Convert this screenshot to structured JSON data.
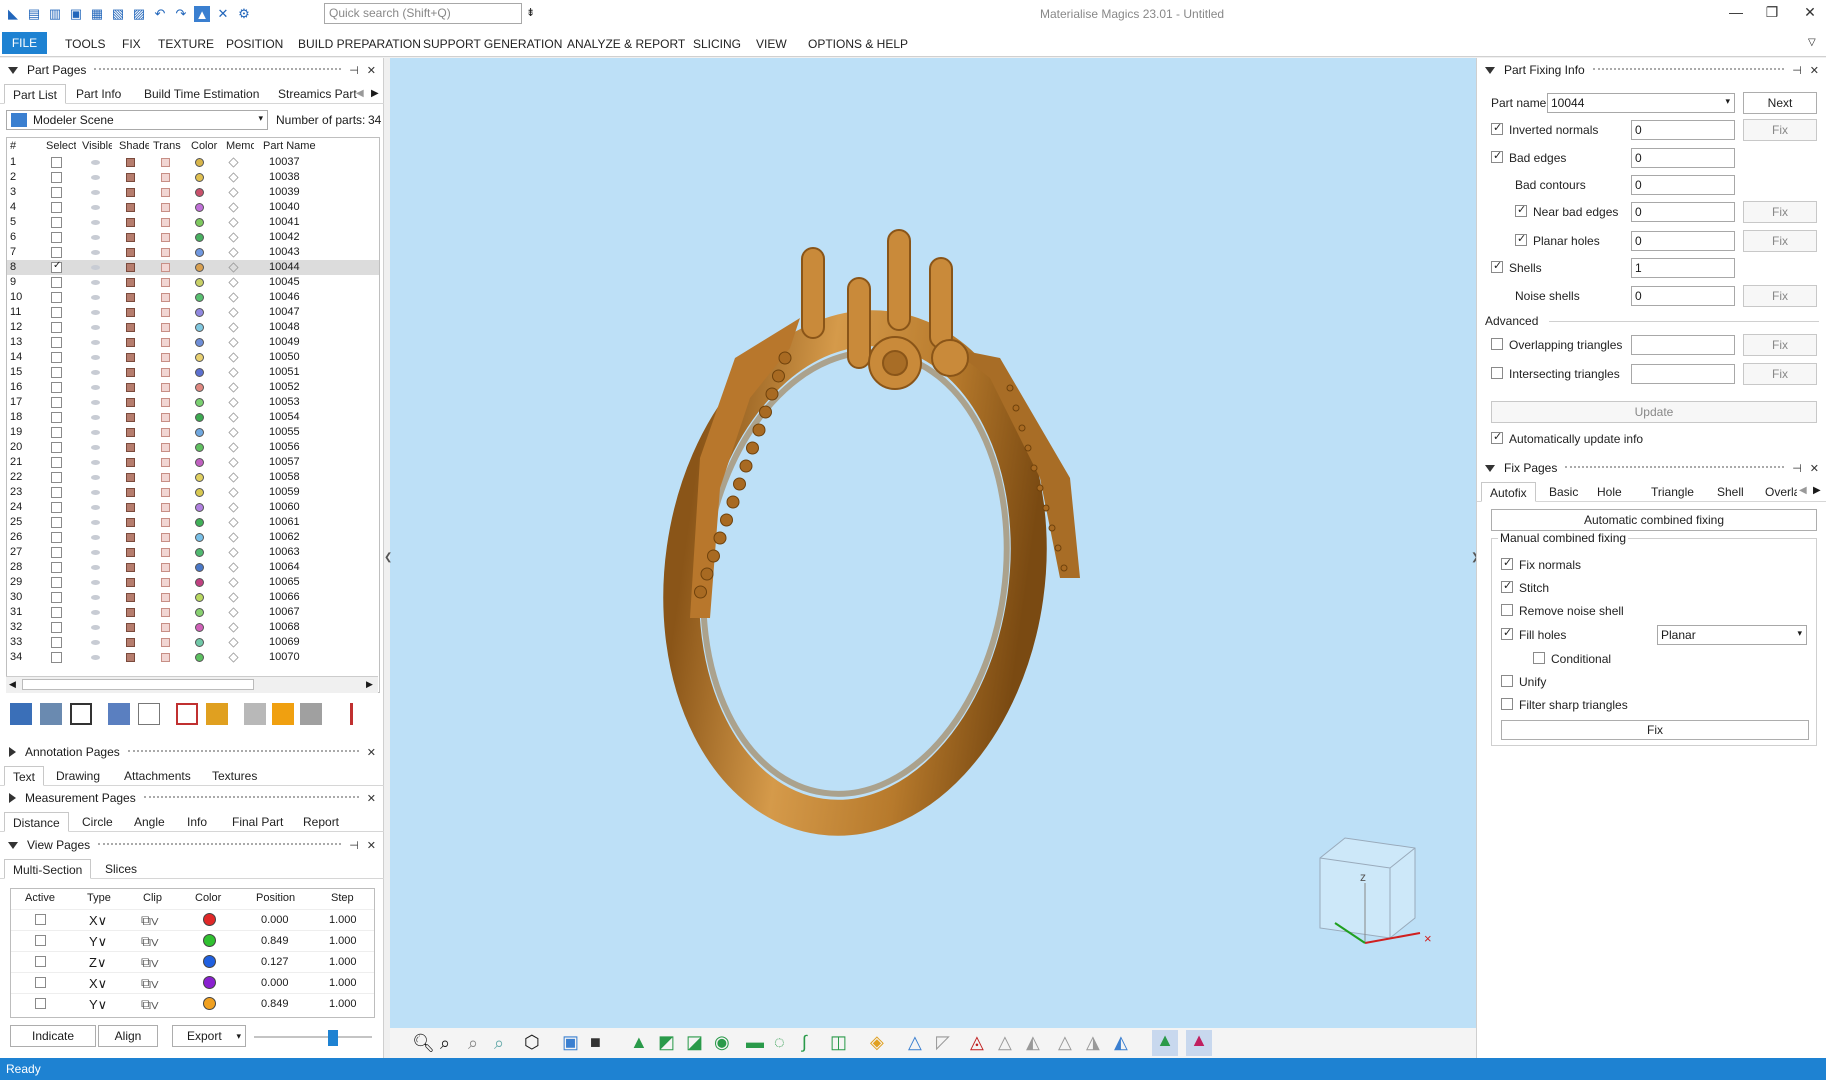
{
  "app": {
    "title": "Materialise Magics 23.01 - Untitled",
    "search_placeholder": "Quick search (Shift+Q)"
  },
  "menu": [
    "FILE",
    "TOOLS",
    "FIX",
    "TEXTURE",
    "POSITION",
    "BUILD PREPARATION",
    "SUPPORT GENERATION",
    "ANALYZE & REPORT",
    "SLICING",
    "VIEW",
    "OPTIONS & HELP"
  ],
  "part_pages": {
    "title": "Part Pages",
    "tabs": [
      "Part List",
      "Part Info",
      "Build Time Estimation",
      "Streamics Part"
    ],
    "scene": "Modeler Scene",
    "number_label": "Number of parts:",
    "number": "34",
    "columns": [
      "#",
      "Select",
      "Visible",
      "Shaded",
      "Trans",
      "Color",
      "Memo",
      "Part Name"
    ],
    "rows": [
      {
        "n": "1",
        "name": "10037",
        "color": "#d8b54a",
        "sel": false
      },
      {
        "n": "2",
        "name": "10038",
        "color": "#e0c050",
        "sel": false
      },
      {
        "n": "3",
        "name": "10039",
        "color": "#c9506b",
        "sel": false
      },
      {
        "n": "4",
        "name": "10040",
        "color": "#c070d8",
        "sel": false
      },
      {
        "n": "5",
        "name": "10041",
        "color": "#7ec85e",
        "sel": false
      },
      {
        "n": "6",
        "name": "10042",
        "color": "#48b060",
        "sel": false
      },
      {
        "n": "7",
        "name": "10043",
        "color": "#7098e0",
        "sel": false
      },
      {
        "n": "8",
        "name": "10044",
        "color": "#d9a050",
        "sel": true
      },
      {
        "n": "9",
        "name": "10045",
        "color": "#c8d066",
        "sel": false
      },
      {
        "n": "10",
        "name": "10046",
        "color": "#58c070",
        "sel": false
      },
      {
        "n": "11",
        "name": "10047",
        "color": "#9088e0",
        "sel": false
      },
      {
        "n": "12",
        "name": "10048",
        "color": "#80c8e0",
        "sel": false
      },
      {
        "n": "13",
        "name": "10049",
        "color": "#6e8ed8",
        "sel": false
      },
      {
        "n": "14",
        "name": "10050",
        "color": "#e8d070",
        "sel": false
      },
      {
        "n": "15",
        "name": "10051",
        "color": "#5c70d0",
        "sel": false
      },
      {
        "n": "16",
        "name": "10052",
        "color": "#e08880",
        "sel": false
      },
      {
        "n": "17",
        "name": "10053",
        "color": "#7ad070",
        "sel": false
      },
      {
        "n": "18",
        "name": "10054",
        "color": "#3caa50",
        "sel": false
      },
      {
        "n": "19",
        "name": "10055",
        "color": "#70a8e0",
        "sel": false
      },
      {
        "n": "20",
        "name": "10056",
        "color": "#60c060",
        "sel": false
      },
      {
        "n": "21",
        "name": "10057",
        "color": "#c060c0",
        "sel": false
      },
      {
        "n": "22",
        "name": "10058",
        "color": "#e0d060",
        "sel": false
      },
      {
        "n": "23",
        "name": "10059",
        "color": "#d8c850",
        "sel": false
      },
      {
        "n": "24",
        "name": "10060",
        "color": "#b080e0",
        "sel": false
      },
      {
        "n": "25",
        "name": "10061",
        "color": "#40b058",
        "sel": false
      },
      {
        "n": "26",
        "name": "10062",
        "color": "#78c0e8",
        "sel": false
      },
      {
        "n": "27",
        "name": "10063",
        "color": "#50b870",
        "sel": false
      },
      {
        "n": "28",
        "name": "10064",
        "color": "#4a78c8",
        "sel": false
      },
      {
        "n": "29",
        "name": "10065",
        "color": "#c04080",
        "sel": false
      },
      {
        "n": "30",
        "name": "10066",
        "color": "#b8d860",
        "sel": false
      },
      {
        "n": "31",
        "name": "10067",
        "color": "#88d070",
        "sel": false
      },
      {
        "n": "32",
        "name": "10068",
        "color": "#d060b8",
        "sel": false
      },
      {
        "n": "33",
        "name": "10069",
        "color": "#70c8a8",
        "sel": false
      },
      {
        "n": "34",
        "name": "10070",
        "color": "#5cc060",
        "sel": false
      }
    ]
  },
  "annotation": {
    "title": "Annotation Pages",
    "tabs": [
      "Text",
      "Drawing",
      "Attachments",
      "Textures"
    ]
  },
  "measurement": {
    "title": "Measurement Pages",
    "tabs": [
      "Distance",
      "Circle",
      "Angle",
      "Info",
      "Final Part",
      "Report"
    ]
  },
  "view_pages": {
    "title": "View Pages",
    "tabs": [
      "Multi-Section",
      "Slices"
    ],
    "columns": [
      "Active",
      "Type",
      "Clip",
      "Color",
      "Position",
      "Step"
    ],
    "rows": [
      {
        "type": "X",
        "color": "#e02828",
        "position": "0.000",
        "step": "1.000"
      },
      {
        "type": "Y",
        "color": "#30c030",
        "position": "0.849",
        "step": "1.000"
      },
      {
        "type": "Z",
        "color": "#2060e0",
        "position": "0.127",
        "step": "1.000"
      },
      {
        "type": "X",
        "color": "#8a20d0",
        "position": "0.000",
        "step": "1.000"
      },
      {
        "type": "Y",
        "color": "#f0a020",
        "position": "0.849",
        "step": "1.000"
      }
    ],
    "buttons": {
      "indicate": "Indicate",
      "align": "Align",
      "export": "Export"
    }
  },
  "part_fixing": {
    "title": "Part Fixing Info",
    "part_name_label": "Part name",
    "part_name": "10044",
    "next": "Next",
    "fix": "Fix",
    "rows": [
      {
        "label": "Inverted normals",
        "value": "0",
        "checked": true,
        "fix": true,
        "indent": false
      },
      {
        "label": "Bad edges",
        "value": "0",
        "checked": true,
        "fix": false,
        "indent": false
      },
      {
        "label": "Bad contours",
        "value": "0",
        "checked": null,
        "fix": false,
        "indent": true
      },
      {
        "label": "Near bad edges",
        "value": "0",
        "checked": true,
        "fix": true,
        "indent": true
      },
      {
        "label": "Planar holes",
        "value": "0",
        "checked": true,
        "fix": true,
        "indent": true
      },
      {
        "label": "Shells",
        "value": "1",
        "checked": true,
        "fix": false,
        "indent": false
      },
      {
        "label": "Noise shells",
        "value": "0",
        "checked": null,
        "fix": true,
        "indent": true
      }
    ],
    "advanced_label": "Advanced",
    "advanced": [
      {
        "label": "Overlapping triangles",
        "value": ""
      },
      {
        "label": "Intersecting triangles",
        "value": ""
      }
    ],
    "update": "Update",
    "auto_update": "Automatically update info"
  },
  "fix_pages": {
    "title": "Fix Pages",
    "tabs": [
      "Autofix",
      "Basic",
      "Hole",
      "Triangle",
      "Shell",
      "Overla"
    ],
    "auto_combined": "Automatic combined fixing",
    "manual_title": "Manual combined fixing",
    "options": [
      {
        "label": "Fix normals",
        "checked": true
      },
      {
        "label": "Stitch",
        "checked": true
      },
      {
        "label": "Remove noise shell",
        "checked": false
      },
      {
        "label": "Fill holes",
        "checked": true
      },
      {
        "label": "Conditional",
        "checked": false
      },
      {
        "label": "Unify",
        "checked": false
      },
      {
        "label": "Filter sharp triangles",
        "checked": false
      }
    ],
    "fill_mode": "Planar",
    "fix": "Fix"
  },
  "colors": {
    "accent": "#1e82d2",
    "viewport_bg": "#bde0f7",
    "ring": "#c98a3a"
  },
  "status": "Ready"
}
